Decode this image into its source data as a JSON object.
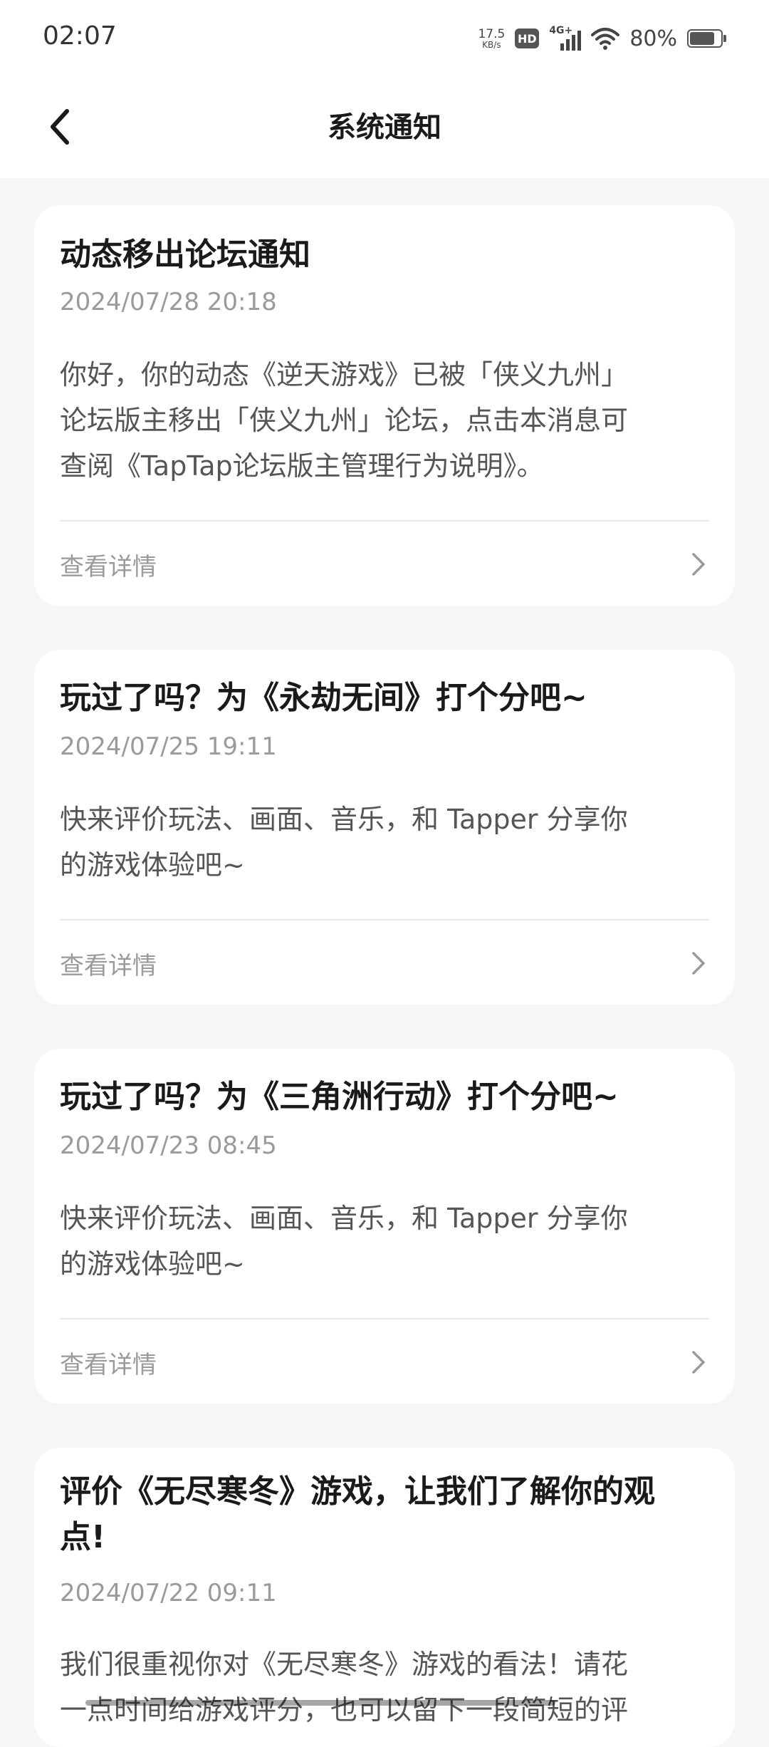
{
  "status_bar": {
    "time": "02:07",
    "net_speed_value": "17.5",
    "net_speed_unit": "KB/s",
    "hd_badge": "HD",
    "network": "4G+",
    "battery_percent": "80%",
    "battery_level": 0.8
  },
  "header": {
    "title": "系统通知",
    "back_icon": "chevron-left-icon"
  },
  "notifications": [
    {
      "title": "动态移出论坛通知",
      "time": "2024/07/28 20:18",
      "body_lines": [
        "你好，你的动态《逆天游戏》已被「侠义九州」",
        "论坛版主移出「侠义九州」论坛，点击本消息可",
        "查阅《TapTap论坛版主管理行为说明》。"
      ],
      "link_label": "查看详情"
    },
    {
      "title": "玩过了吗？为《永劫无间》打个分吧~",
      "time": "2024/07/25 19:11",
      "body_lines": [
        "快来评价玩法、画面、音乐，和 Tapper 分享你",
        "的游戏体验吧~"
      ],
      "link_label": "查看详情"
    },
    {
      "title": "玩过了吗？为《三角洲行动》打个分吧~",
      "time": "2024/07/23 08:45",
      "body_lines": [
        "快来评价玩法、画面、音乐，和 Tapper 分享你",
        "的游戏体验吧~"
      ],
      "link_label": "查看详情"
    },
    {
      "title_lines": [
        "评价《无尽寒冬》游戏，让我们了解你的观",
        "点!"
      ],
      "time": "2024/07/22 09:11",
      "body_lines": [
        "我们很重视你对《无尽寒冬》游戏的看法！请花",
        "一点时间给游戏评分，也可以留下一段简短的评"
      ]
    }
  ],
  "colors": {
    "background": "#f5f6f8",
    "card": "#ffffff",
    "title_text": "#1a1a1a",
    "muted_text": "#9a9a9a",
    "body_text": "#555555"
  }
}
